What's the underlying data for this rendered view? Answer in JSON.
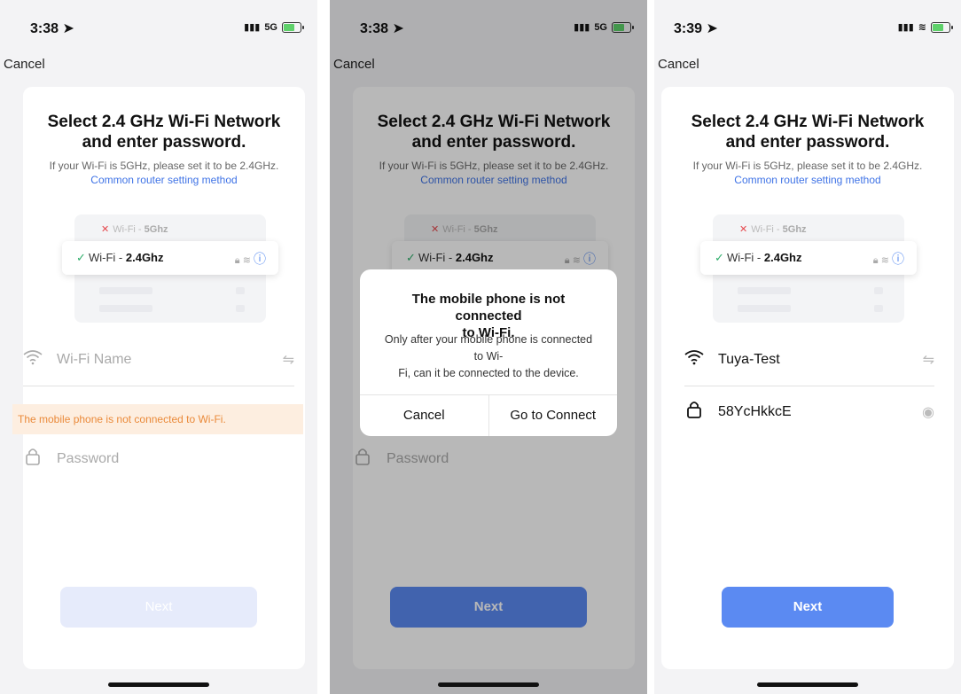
{
  "screens": [
    {
      "time": "3:38",
      "network": "5G",
      "cancel": "Cancel",
      "title_line1": "Select 2.4 GHz Wi-Fi Network",
      "title_line2": "and enter password.",
      "subtitle": "If your Wi-Fi is 5GHz, please set it to be 2.4GHz.",
      "link": "Common router setting method",
      "ill_row1_prefix": "Wi-Fi - ",
      "ill_row1_bold": "5Ghz",
      "ill_row2_prefix": "Wi-Fi - ",
      "ill_row2_bold": "2.4Ghz",
      "wifi_placeholder": "Wi-Fi Name",
      "warning": "The mobile phone is not connected to Wi-Fi.",
      "password_placeholder": "Password",
      "next": "Next"
    },
    {
      "time": "3:38",
      "network": "5G",
      "cancel": "Cancel",
      "title_line1": "Select 2.4 GHz Wi-Fi Network",
      "title_line2": "and enter password.",
      "subtitle": "If your Wi-Fi is 5GHz, please set it to be 2.4GHz.",
      "link": "Common router setting method",
      "ill_row1_prefix": "Wi-Fi - ",
      "ill_row1_bold": "5Ghz",
      "ill_row2_prefix": "Wi-Fi - ",
      "ill_row2_bold": "2.4Ghz",
      "password_placeholder": "Password",
      "next": "Next",
      "alert": {
        "title_line1": "The mobile phone is not connected",
        "title_line2": "to Wi-Fi.",
        "msg_line1": "Only after your mobile phone is connected",
        "msg_line2": "to Wi-",
        "msg_line3": "Fi, can it be connected to the device.",
        "cancel": "Cancel",
        "connect": "Go to Connect"
      }
    },
    {
      "time": "3:39",
      "cancel": "Cancel",
      "title_line1": "Select 2.4 GHz Wi-Fi Network",
      "title_line2": "and enter password.",
      "subtitle": "If your Wi-Fi is 5GHz, please set it to be 2.4GHz.",
      "link": "Common router setting method",
      "ill_row1_prefix": "Wi-Fi - ",
      "ill_row1_bold": "5Ghz",
      "ill_row2_prefix": "Wi-Fi - ",
      "ill_row2_bold": "2.4Ghz",
      "wifi_value": "Tuya-Test",
      "password_value": "58YcHkkcE",
      "next": "Next"
    }
  ],
  "icons": {
    "location_arrow": "location-arrow-icon",
    "wifi": "wifi-icon",
    "lock": "lock-icon",
    "swap": "swap-icon",
    "eye": "eye-icon",
    "info": "info-icon"
  },
  "colors": {
    "accent": "#5b8af2",
    "link": "#3f73e6",
    "warning_bg": "#fdeee0",
    "warning_text": "#ea8a3a"
  }
}
